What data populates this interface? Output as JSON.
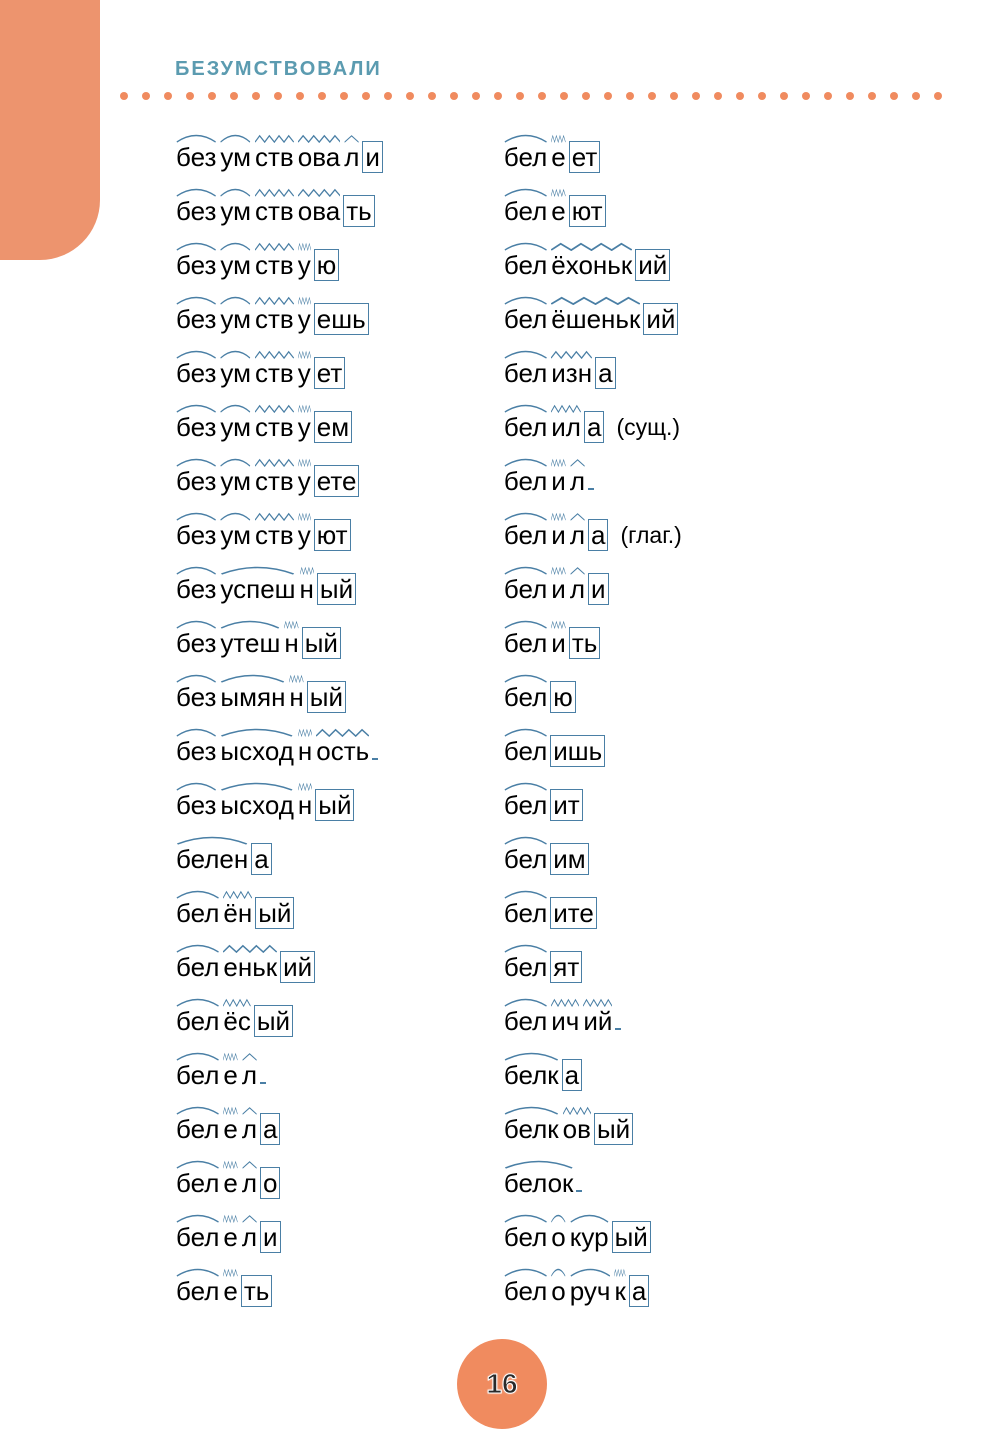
{
  "header": "БЕЗУМСТВОВАЛИ",
  "page_number": "16",
  "columns": [
    [
      {
        "morphemes": [
          {
            "t": "без",
            "mark": "arc"
          },
          {
            "t": "ум",
            "mark": "arc"
          },
          {
            "t": "ств",
            "mark": "zig"
          },
          {
            "t": "ова",
            "mark": "zig"
          },
          {
            "t": "л",
            "mark": "hat"
          },
          {
            "t": "и",
            "box": true
          }
        ]
      },
      {
        "morphemes": [
          {
            "t": "без",
            "mark": "arc"
          },
          {
            "t": "ум",
            "mark": "arc"
          },
          {
            "t": "ств",
            "mark": "zig"
          },
          {
            "t": "ова",
            "mark": "zig"
          },
          {
            "t": "ть",
            "box": true
          }
        ]
      },
      {
        "morphemes": [
          {
            "t": "без",
            "mark": "arc"
          },
          {
            "t": "ум",
            "mark": "arc"
          },
          {
            "t": "ств",
            "mark": "zig"
          },
          {
            "t": "у",
            "mark": "zig"
          },
          {
            "t": "ю",
            "box": true
          }
        ]
      },
      {
        "morphemes": [
          {
            "t": "без",
            "mark": "arc"
          },
          {
            "t": "ум",
            "mark": "arc"
          },
          {
            "t": "ств",
            "mark": "zig"
          },
          {
            "t": "у",
            "mark": "zig"
          },
          {
            "t": "ешь",
            "box": true
          }
        ]
      },
      {
        "morphemes": [
          {
            "t": "без",
            "mark": "arc"
          },
          {
            "t": "ум",
            "mark": "arc"
          },
          {
            "t": "ств",
            "mark": "zig"
          },
          {
            "t": "у",
            "mark": "zig"
          },
          {
            "t": "ет",
            "box": true
          }
        ]
      },
      {
        "morphemes": [
          {
            "t": "без",
            "mark": "arc"
          },
          {
            "t": "ум",
            "mark": "arc"
          },
          {
            "t": "ств",
            "mark": "zig"
          },
          {
            "t": "у",
            "mark": "zig"
          },
          {
            "t": "ем",
            "box": true
          }
        ]
      },
      {
        "morphemes": [
          {
            "t": "без",
            "mark": "arc"
          },
          {
            "t": "ум",
            "mark": "arc"
          },
          {
            "t": "ств",
            "mark": "zig"
          },
          {
            "t": "у",
            "mark": "zig"
          },
          {
            "t": "ете",
            "box": true
          }
        ]
      },
      {
        "morphemes": [
          {
            "t": "без",
            "mark": "arc"
          },
          {
            "t": "ум",
            "mark": "arc"
          },
          {
            "t": "ств",
            "mark": "zig"
          },
          {
            "t": "у",
            "mark": "zig"
          },
          {
            "t": "ют",
            "box": true
          }
        ]
      },
      {
        "morphemes": [
          {
            "t": "без",
            "mark": "arc"
          },
          {
            "t": "успеш",
            "mark": "arc"
          },
          {
            "t": "н",
            "mark": "zig"
          },
          {
            "t": "ый",
            "box": true
          }
        ]
      },
      {
        "morphemes": [
          {
            "t": "без",
            "mark": "arc"
          },
          {
            "t": "утеш",
            "mark": "arc"
          },
          {
            "t": "н",
            "mark": "zig"
          },
          {
            "t": "ый",
            "box": true
          }
        ]
      },
      {
        "morphemes": [
          {
            "t": "без",
            "mark": "arc"
          },
          {
            "t": "ымян",
            "mark": "arc"
          },
          {
            "t": "н",
            "mark": "zig"
          },
          {
            "t": "ый",
            "box": true
          }
        ]
      },
      {
        "morphemes": [
          {
            "t": "без",
            "mark": "arc"
          },
          {
            "t": "ысход",
            "mark": "arc"
          },
          {
            "t": "н",
            "mark": "zig"
          },
          {
            "t": "ость",
            "mark": "zig"
          },
          {
            "t": " ",
            "box": true
          }
        ]
      },
      {
        "morphemes": [
          {
            "t": "без",
            "mark": "arc"
          },
          {
            "t": "ысход",
            "mark": "arc"
          },
          {
            "t": "н",
            "mark": "zig"
          },
          {
            "t": "ый",
            "box": true
          }
        ]
      },
      {
        "morphemes": [
          {
            "t": "белен",
            "mark": "arc"
          },
          {
            "t": "а",
            "box": true
          }
        ]
      },
      {
        "morphemes": [
          {
            "t": "бел",
            "mark": "arc"
          },
          {
            "t": "ён",
            "mark": "zig"
          },
          {
            "t": "ый",
            "box": true
          }
        ]
      },
      {
        "morphemes": [
          {
            "t": "бел",
            "mark": "arc"
          },
          {
            "t": "еньк",
            "mark": "zig"
          },
          {
            "t": "ий",
            "box": true
          }
        ]
      },
      {
        "morphemes": [
          {
            "t": "бел",
            "mark": "arc"
          },
          {
            "t": "ёс",
            "mark": "zig"
          },
          {
            "t": "ый",
            "box": true
          }
        ]
      },
      {
        "morphemes": [
          {
            "t": "бел",
            "mark": "arc"
          },
          {
            "t": "е",
            "mark": "zig"
          },
          {
            "t": "л",
            "mark": "hat"
          },
          {
            "t": " ",
            "box": true
          }
        ]
      },
      {
        "morphemes": [
          {
            "t": "бел",
            "mark": "arc"
          },
          {
            "t": "е",
            "mark": "zig"
          },
          {
            "t": "л",
            "mark": "hat"
          },
          {
            "t": "а",
            "box": true
          }
        ]
      },
      {
        "morphemes": [
          {
            "t": "бел",
            "mark": "arc"
          },
          {
            "t": "е",
            "mark": "zig"
          },
          {
            "t": "л",
            "mark": "hat"
          },
          {
            "t": "о",
            "box": true
          }
        ]
      },
      {
        "morphemes": [
          {
            "t": "бел",
            "mark": "arc"
          },
          {
            "t": "е",
            "mark": "zig"
          },
          {
            "t": "л",
            "mark": "hat"
          },
          {
            "t": "и",
            "box": true
          }
        ]
      },
      {
        "morphemes": [
          {
            "t": "бел",
            "mark": "arc"
          },
          {
            "t": "е",
            "mark": "zig"
          },
          {
            "t": "ть",
            "box": true
          }
        ]
      }
    ],
    [
      {
        "morphemes": [
          {
            "t": "бел",
            "mark": "arc"
          },
          {
            "t": "е",
            "mark": "zig"
          },
          {
            "t": "ет",
            "box": true
          }
        ]
      },
      {
        "morphemes": [
          {
            "t": "бел",
            "mark": "arc"
          },
          {
            "t": "е",
            "mark": "zig"
          },
          {
            "t": "ют",
            "box": true
          }
        ]
      },
      {
        "morphemes": [
          {
            "t": "бел",
            "mark": "arc"
          },
          {
            "t": "ёхоньк",
            "mark": "zig"
          },
          {
            "t": "ий",
            "box": true
          }
        ]
      },
      {
        "morphemes": [
          {
            "t": "бел",
            "mark": "arc"
          },
          {
            "t": "ёшеньк",
            "mark": "zig"
          },
          {
            "t": "ий",
            "box": true
          }
        ]
      },
      {
        "morphemes": [
          {
            "t": "бел",
            "mark": "arc"
          },
          {
            "t": "изн",
            "mark": "zig"
          },
          {
            "t": "а",
            "box": true
          }
        ]
      },
      {
        "morphemes": [
          {
            "t": "бел",
            "mark": "arc"
          },
          {
            "t": "ил",
            "mark": "zig"
          },
          {
            "t": "а",
            "box": true
          }
        ],
        "annotation": "(сущ.)"
      },
      {
        "morphemes": [
          {
            "t": "бел",
            "mark": "arc"
          },
          {
            "t": "и",
            "mark": "zig"
          },
          {
            "t": "л",
            "mark": "hat"
          },
          {
            "t": " ",
            "box": true
          }
        ]
      },
      {
        "morphemes": [
          {
            "t": "бел",
            "mark": "arc"
          },
          {
            "t": "и",
            "mark": "zig"
          },
          {
            "t": "л",
            "mark": "hat"
          },
          {
            "t": "а",
            "box": true
          }
        ],
        "annotation": "(глаг.)"
      },
      {
        "morphemes": [
          {
            "t": "бел",
            "mark": "arc"
          },
          {
            "t": "и",
            "mark": "zig"
          },
          {
            "t": "л",
            "mark": "hat"
          },
          {
            "t": "и",
            "box": true
          }
        ]
      },
      {
        "morphemes": [
          {
            "t": "бел",
            "mark": "arc"
          },
          {
            "t": "и",
            "mark": "zig"
          },
          {
            "t": "ть",
            "box": true
          }
        ]
      },
      {
        "morphemes": [
          {
            "t": "бел",
            "mark": "arc"
          },
          {
            "t": "ю",
            "box": true
          }
        ]
      },
      {
        "morphemes": [
          {
            "t": "бел",
            "mark": "arc"
          },
          {
            "t": "ишь",
            "box": true
          }
        ]
      },
      {
        "morphemes": [
          {
            "t": "бел",
            "mark": "arc"
          },
          {
            "t": "ит",
            "box": true
          }
        ]
      },
      {
        "morphemes": [
          {
            "t": "бел",
            "mark": "arc"
          },
          {
            "t": "им",
            "box": true
          }
        ]
      },
      {
        "morphemes": [
          {
            "t": "бел",
            "mark": "arc"
          },
          {
            "t": "ите",
            "box": true
          }
        ]
      },
      {
        "morphemes": [
          {
            "t": "бел",
            "mark": "arc"
          },
          {
            "t": "ят",
            "box": true
          }
        ]
      },
      {
        "morphemes": [
          {
            "t": "бел",
            "mark": "arc"
          },
          {
            "t": "ич",
            "mark": "zig"
          },
          {
            "t": "ий",
            "mark": "zig"
          },
          {
            "t": " ",
            "box": true
          }
        ]
      },
      {
        "morphemes": [
          {
            "t": "белк",
            "mark": "arc"
          },
          {
            "t": "а",
            "box": true
          }
        ]
      },
      {
        "morphemes": [
          {
            "t": "белк",
            "mark": "arc"
          },
          {
            "t": "ов",
            "mark": "zig"
          },
          {
            "t": "ый",
            "box": true
          }
        ]
      },
      {
        "morphemes": [
          {
            "t": "белок",
            "mark": "arc"
          },
          {
            "t": " ",
            "box": true
          }
        ]
      },
      {
        "morphemes": [
          {
            "t": "бел",
            "mark": "arc"
          },
          {
            "t": "о",
            "mark": "arc"
          },
          {
            "t": "кур",
            "mark": "arc"
          },
          {
            "t": "ый",
            "box": true
          }
        ]
      },
      {
        "morphemes": [
          {
            "t": "бел",
            "mark": "arc"
          },
          {
            "t": "о",
            "mark": "arc"
          },
          {
            "t": "руч",
            "mark": "arc"
          },
          {
            "t": "к",
            "mark": "zig"
          },
          {
            "t": "а",
            "box": true
          }
        ]
      }
    ]
  ]
}
